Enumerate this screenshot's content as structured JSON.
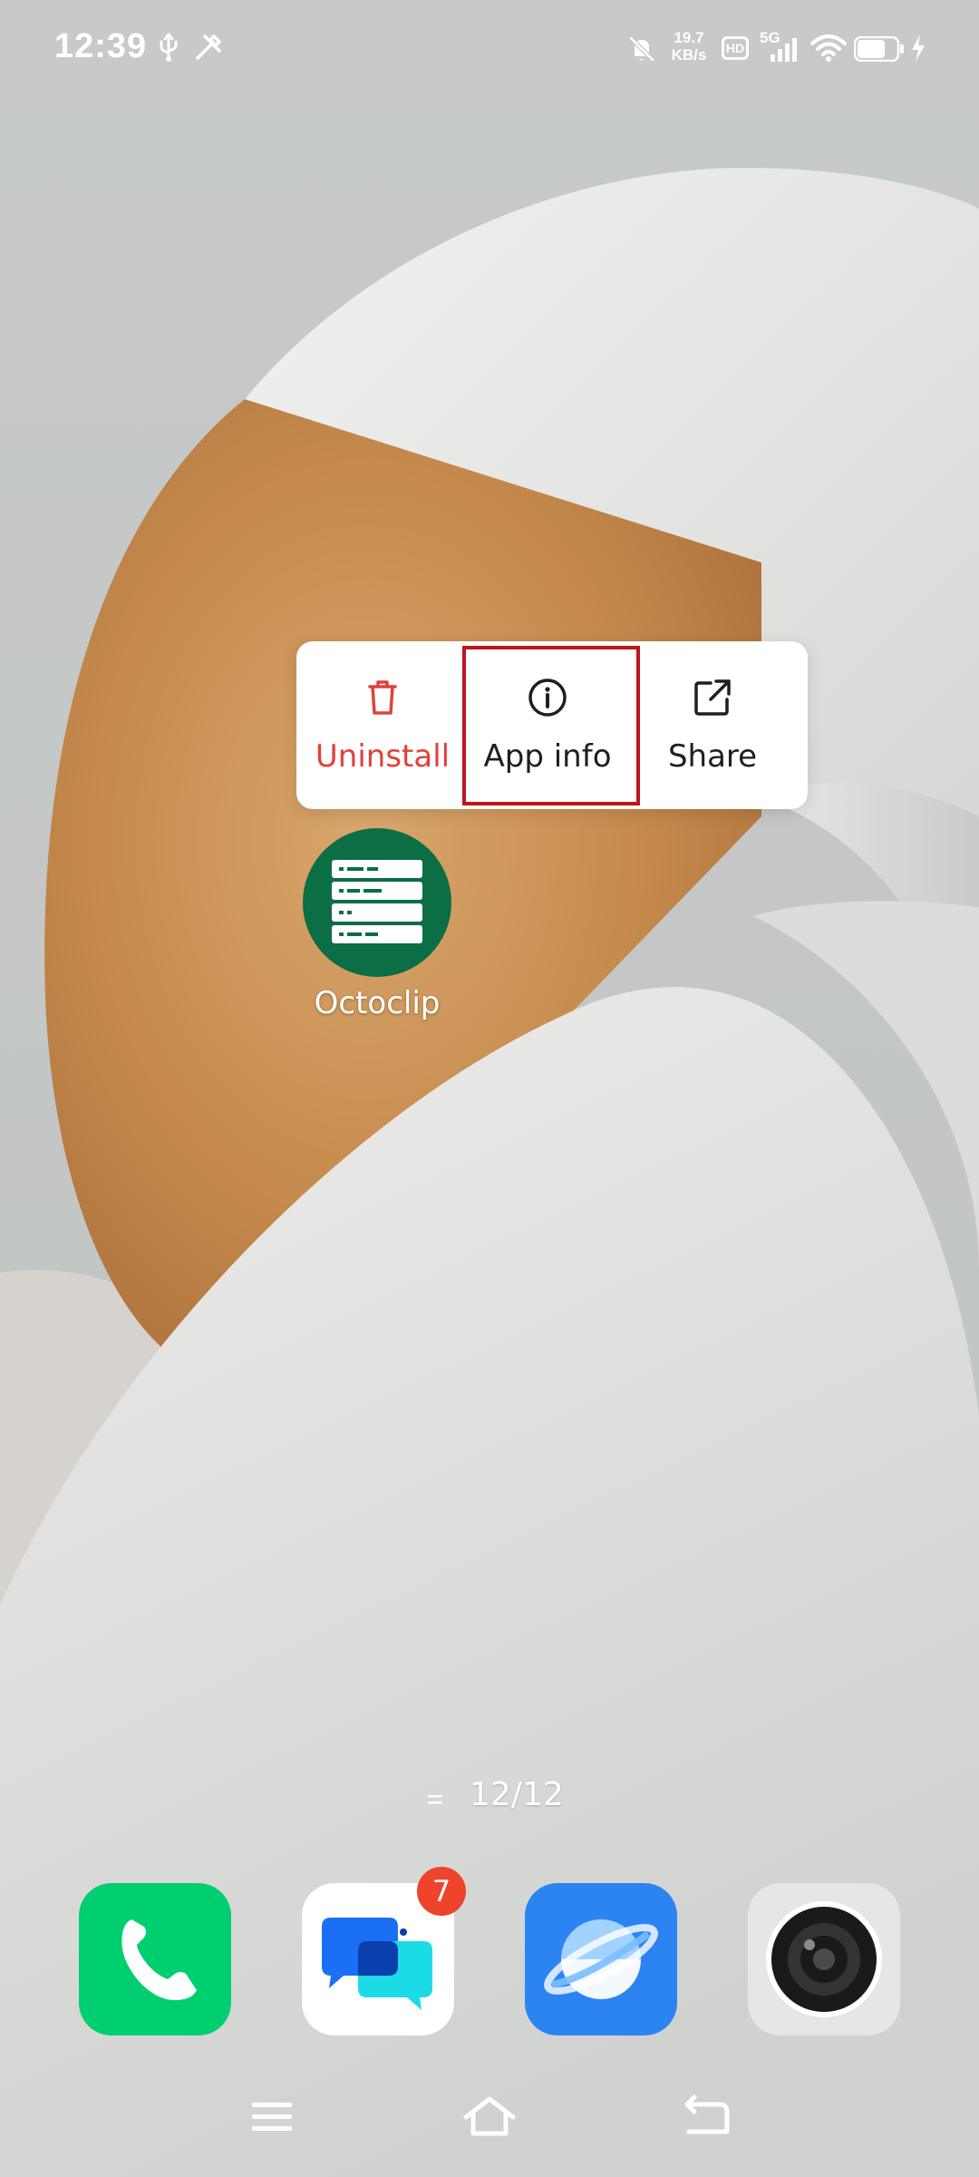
{
  "status_bar": {
    "time": "12:39",
    "net_speed_value": "19.7",
    "net_speed_unit": "KB/s",
    "hd_label": "HD",
    "network_label": "5G"
  },
  "popup_menu": {
    "items": [
      {
        "label": "Uninstall",
        "icon": "trash-icon",
        "color": "#e0413b"
      },
      {
        "label": "App info",
        "icon": "info-icon",
        "color": "#1f1f1f"
      },
      {
        "label": "Share",
        "icon": "share-icon",
        "color": "#1f1f1f"
      }
    ],
    "highlight_color": "#c0151b"
  },
  "app": {
    "name": "Octoclip",
    "icon": "server-list-icon",
    "icon_color": "#0b6e45"
  },
  "page_indicator": {
    "text": "12/12"
  },
  "dock": {
    "apps": [
      {
        "name": "phone",
        "icon": "phone-icon",
        "color": "#00cf6f"
      },
      {
        "name": "messages",
        "icon": "chat-icon",
        "color": "#ffffff",
        "badge": "7"
      },
      {
        "name": "browser",
        "icon": "planet-icon",
        "color": "#2c84f2"
      },
      {
        "name": "camera",
        "icon": "camera-icon",
        "color": "#e6e6e6"
      }
    ]
  },
  "nav_bar": {
    "buttons": [
      "menu-icon",
      "home-icon",
      "back-icon"
    ]
  }
}
